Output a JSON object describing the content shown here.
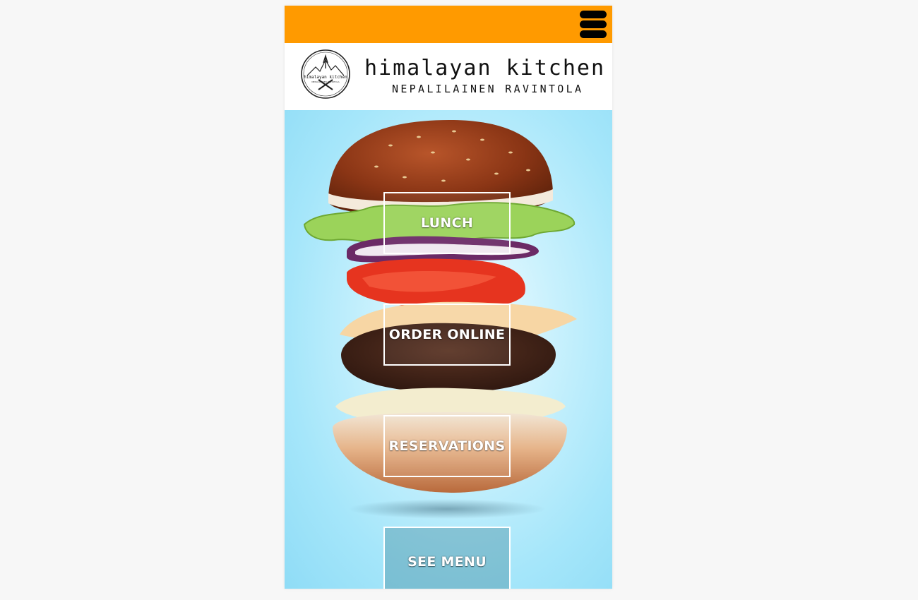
{
  "header": {
    "menu_icon": "hamburger-menu-icon",
    "accent_color": "#ff9a00"
  },
  "brand": {
    "name": "himalayan kitchen",
    "tagline": "NEPALILAINEN RAVINTOLA",
    "seal_text": "himalayan kitchen"
  },
  "hero": {
    "background_color": "#a5e6fa",
    "image": "floating burger layers"
  },
  "nav": {
    "lunch_label": "Lunch",
    "order_label": "Order Online",
    "reservations_label": "Reservations",
    "menu_label": "See Menu"
  }
}
